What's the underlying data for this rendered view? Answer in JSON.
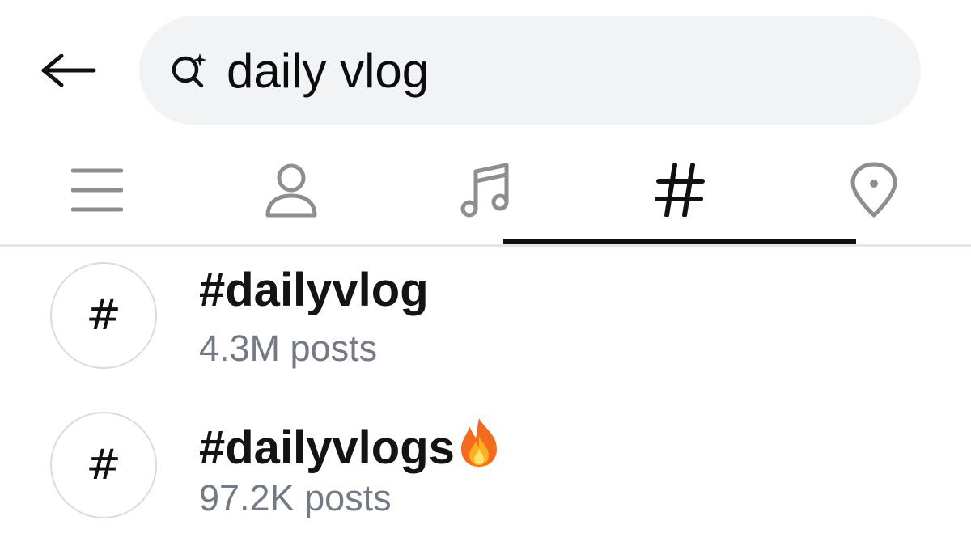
{
  "search": {
    "value": "daily vlog",
    "search_icon": "search-sparkle-icon",
    "back_icon": "arrow-left-icon"
  },
  "tabs": [
    {
      "id": "top",
      "icon": "list-icon",
      "selected": false
    },
    {
      "id": "accounts",
      "icon": "person-icon",
      "selected": false
    },
    {
      "id": "audio",
      "icon": "music-note-icon",
      "selected": false
    },
    {
      "id": "tags",
      "icon": "hashtag-icon",
      "label": "#",
      "selected": true
    },
    {
      "id": "places",
      "icon": "location-pin-icon",
      "selected": false
    }
  ],
  "results": [
    {
      "icon_label": "#",
      "name": "#dailyvlog",
      "count": "4.3M posts",
      "emoji": ""
    },
    {
      "icon_label": "#",
      "name": "#dailyvlogs",
      "count": "97.2K posts",
      "emoji": "fire-emoji-icon"
    }
  ],
  "colors": {
    "search_bg": "#f2f3f5",
    "active_tab": "#111111",
    "inactive_icon": "#8e8e8e",
    "secondary_text": "#737a85",
    "divider": "#e6e6e6"
  }
}
